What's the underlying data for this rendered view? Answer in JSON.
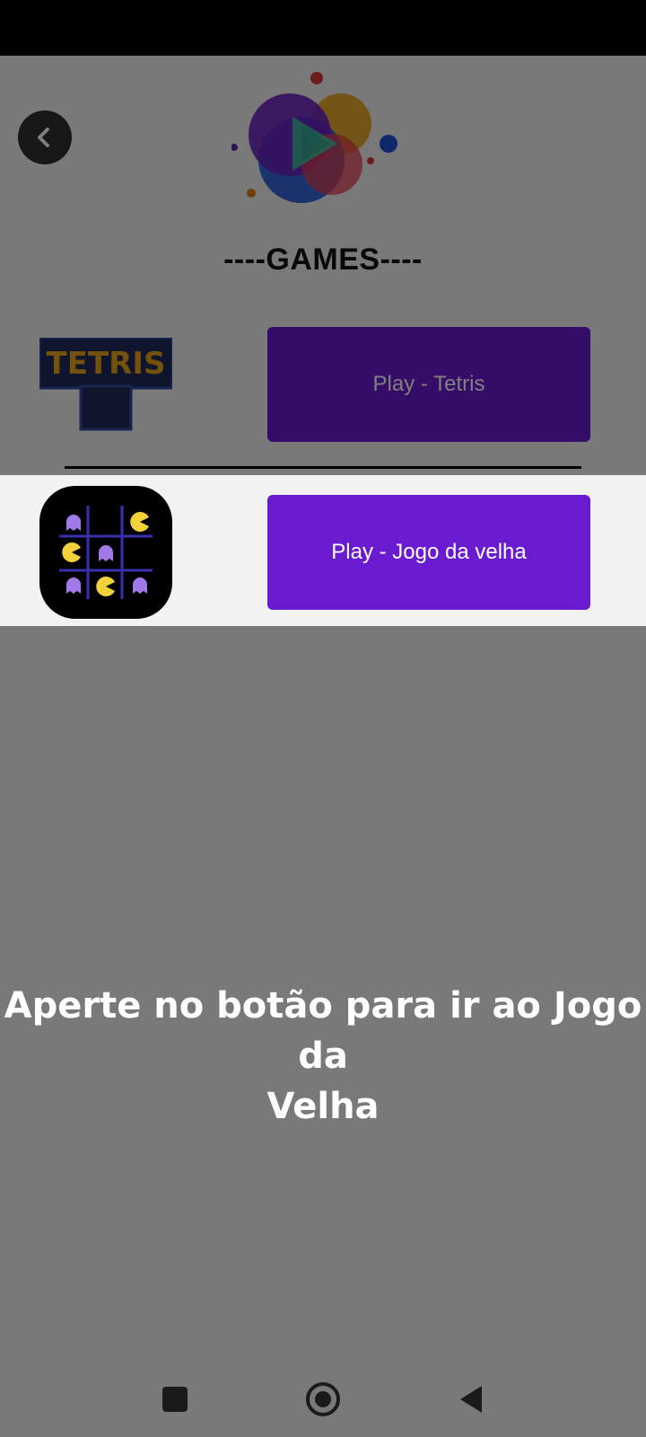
{
  "header": {
    "title": "----GAMES----",
    "back_icon": "chevron-left-icon",
    "logo": "colorful-circles-play-logo"
  },
  "games": [
    {
      "name": "Tetris",
      "thumbnail_text": "TETRIS",
      "button_label": "Play - Tetris"
    },
    {
      "name": "Jogo da velha",
      "button_label": "Play - Jogo da velha"
    }
  ],
  "tutorial": {
    "tip_line1": "Aperte no botão para ir ao Jogo da",
    "tip_line2": "Velha"
  },
  "nav": {
    "recents_icon": "square-icon",
    "home_icon": "circle-home-icon",
    "back_icon": "triangle-back-icon"
  },
  "colors": {
    "accent": "#6a1bd0",
    "overlay": "rgba(0,0,0,0.5)"
  }
}
